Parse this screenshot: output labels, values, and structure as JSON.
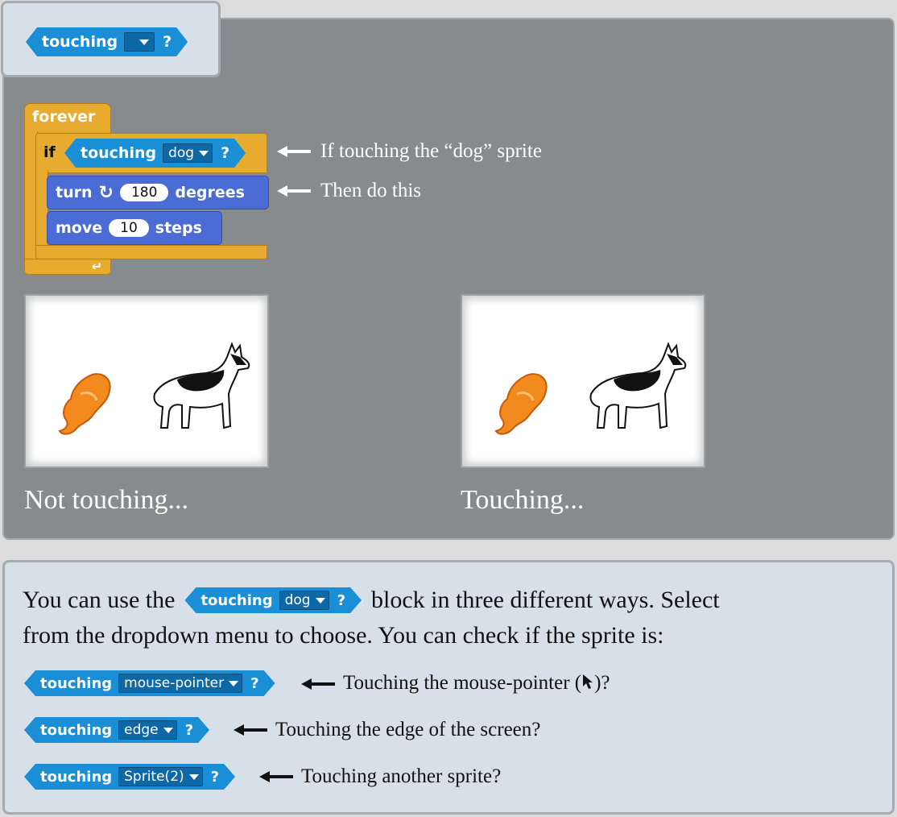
{
  "top_block": {
    "keyword": "touching",
    "dropdown": "",
    "question": "?"
  },
  "script": {
    "forever": "forever",
    "if": "if",
    "if_condition": {
      "keyword": "touching",
      "dropdown": "dog",
      "question": "?"
    },
    "turn": {
      "keyword": "turn",
      "value": "180",
      "unit": "degrees"
    },
    "move": {
      "keyword": "move",
      "value": "10",
      "unit": "steps"
    }
  },
  "annotations": [
    "If touching the “dog” sprite",
    "Then do this"
  ],
  "stages": [
    {
      "caption": "Not touching..."
    },
    {
      "caption": "Touching..."
    }
  ],
  "info": {
    "line1_before": "You can use the",
    "inline_block": {
      "keyword": "touching",
      "dropdown": "dog",
      "question": "?"
    },
    "line1_after": "block in three different ways. Select",
    "line2": "from the dropdown menu to choose. You can check if the sprite is:",
    "options": [
      {
        "keyword": "touching",
        "dropdown": "mouse-pointer",
        "question": "?",
        "note_before": "Touching the mouse-pointer (",
        "note_after": ")?"
      },
      {
        "keyword": "touching",
        "dropdown": "edge",
        "question": "?",
        "note": "Touching the edge of the screen?"
      },
      {
        "keyword": "touching",
        "dropdown": "Sprite(2)",
        "question": "?",
        "note": "Touching another sprite?"
      }
    ]
  },
  "colors": {
    "sensing": "#1a8fd6",
    "control": "#e7ac2f",
    "motion": "#4a6cd4"
  }
}
